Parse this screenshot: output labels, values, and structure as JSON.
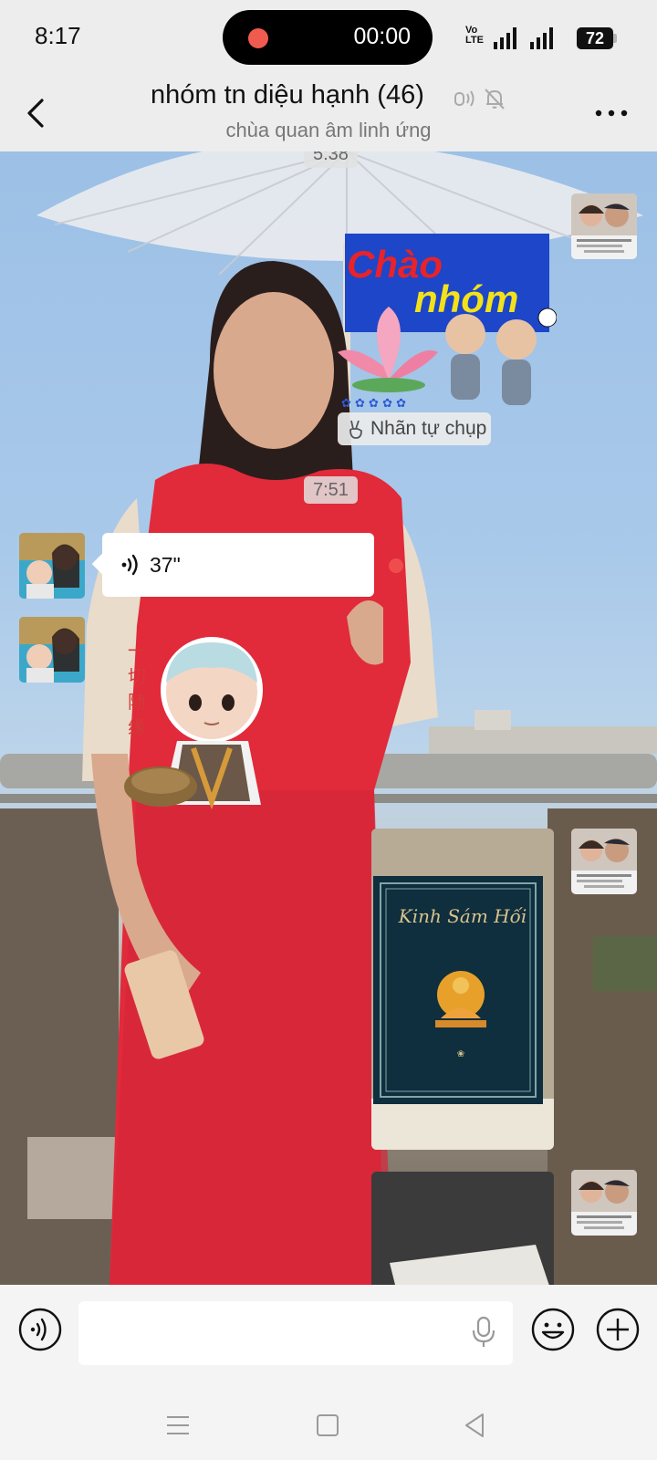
{
  "status_bar": {
    "time": "8:17",
    "recording_time": "00:00",
    "network_label_1": "Vo",
    "network_label_2": "LTE",
    "battery": "72"
  },
  "header": {
    "title": "nhóm tn diệu hạnh (46)",
    "subtitle": "chùa quan âm linh ứng"
  },
  "messages": {
    "time_1": "5:38",
    "sticker_line_1": "Chào",
    "sticker_line_2": "nhóm",
    "selfie_tag": "Nhãn tự chụp",
    "time_2": "7:51",
    "voice_duration": "37\"",
    "book_title": "Kinh Sám Hối"
  },
  "input": {
    "placeholder": ""
  },
  "colors": {
    "accent_red": "#ef4d4d",
    "background": "#ededed"
  },
  "icons": [
    "back-icon",
    "voice-wave-icon",
    "mute-bell-icon",
    "more-icon",
    "peace-hand-icon",
    "microphone-icon",
    "emoji-icon",
    "plus-icon",
    "menu-icon",
    "home-square-icon",
    "back-triangle-icon"
  ]
}
